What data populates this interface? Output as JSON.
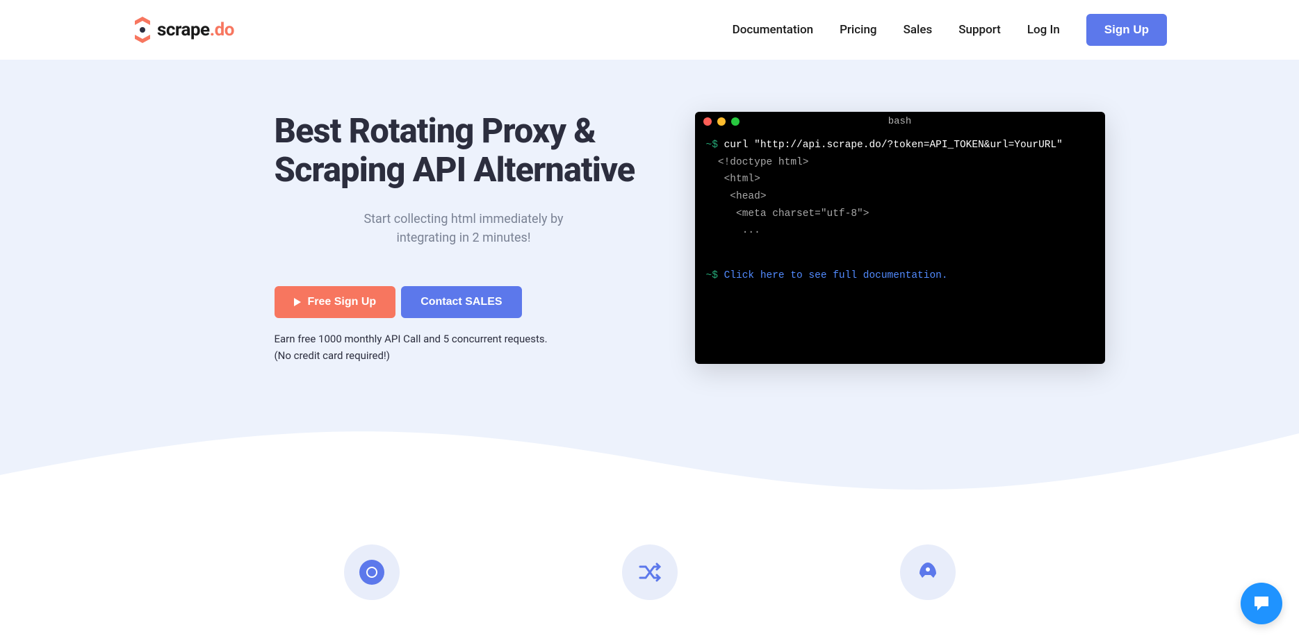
{
  "logo": {
    "text_main": "scrape",
    "text_sep": ".",
    "text_do": "do"
  },
  "nav": {
    "items": [
      {
        "label": "Documentation"
      },
      {
        "label": "Pricing"
      },
      {
        "label": "Sales"
      },
      {
        "label": "Support"
      },
      {
        "label": "Log In"
      }
    ],
    "signup": "Sign Up"
  },
  "hero": {
    "title": "Best Rotating Proxy & Scraping API Alternative",
    "subtitle": "Start collecting html immediately by integrating in 2 minutes!",
    "free_signup": "Free Sign Up",
    "contact_sales": "Contact SALES",
    "fine_print_1": "Earn free 1000 monthly API Call and 5 concurrent requests.",
    "fine_print_2": "(No credit card required!)"
  },
  "terminal": {
    "title": "bash",
    "prompt": "~$",
    "cmd": " curl \"http://api.scrape.do/?token=API_TOKEN&url=YourURL\"",
    "out1": "  <!doctype html>",
    "out2": "   <html>",
    "out3": "    <head>",
    "out4": "     <meta charset=\"utf-8\">",
    "out5": "      ...",
    "doc_link": "Click here to see full documentation."
  }
}
